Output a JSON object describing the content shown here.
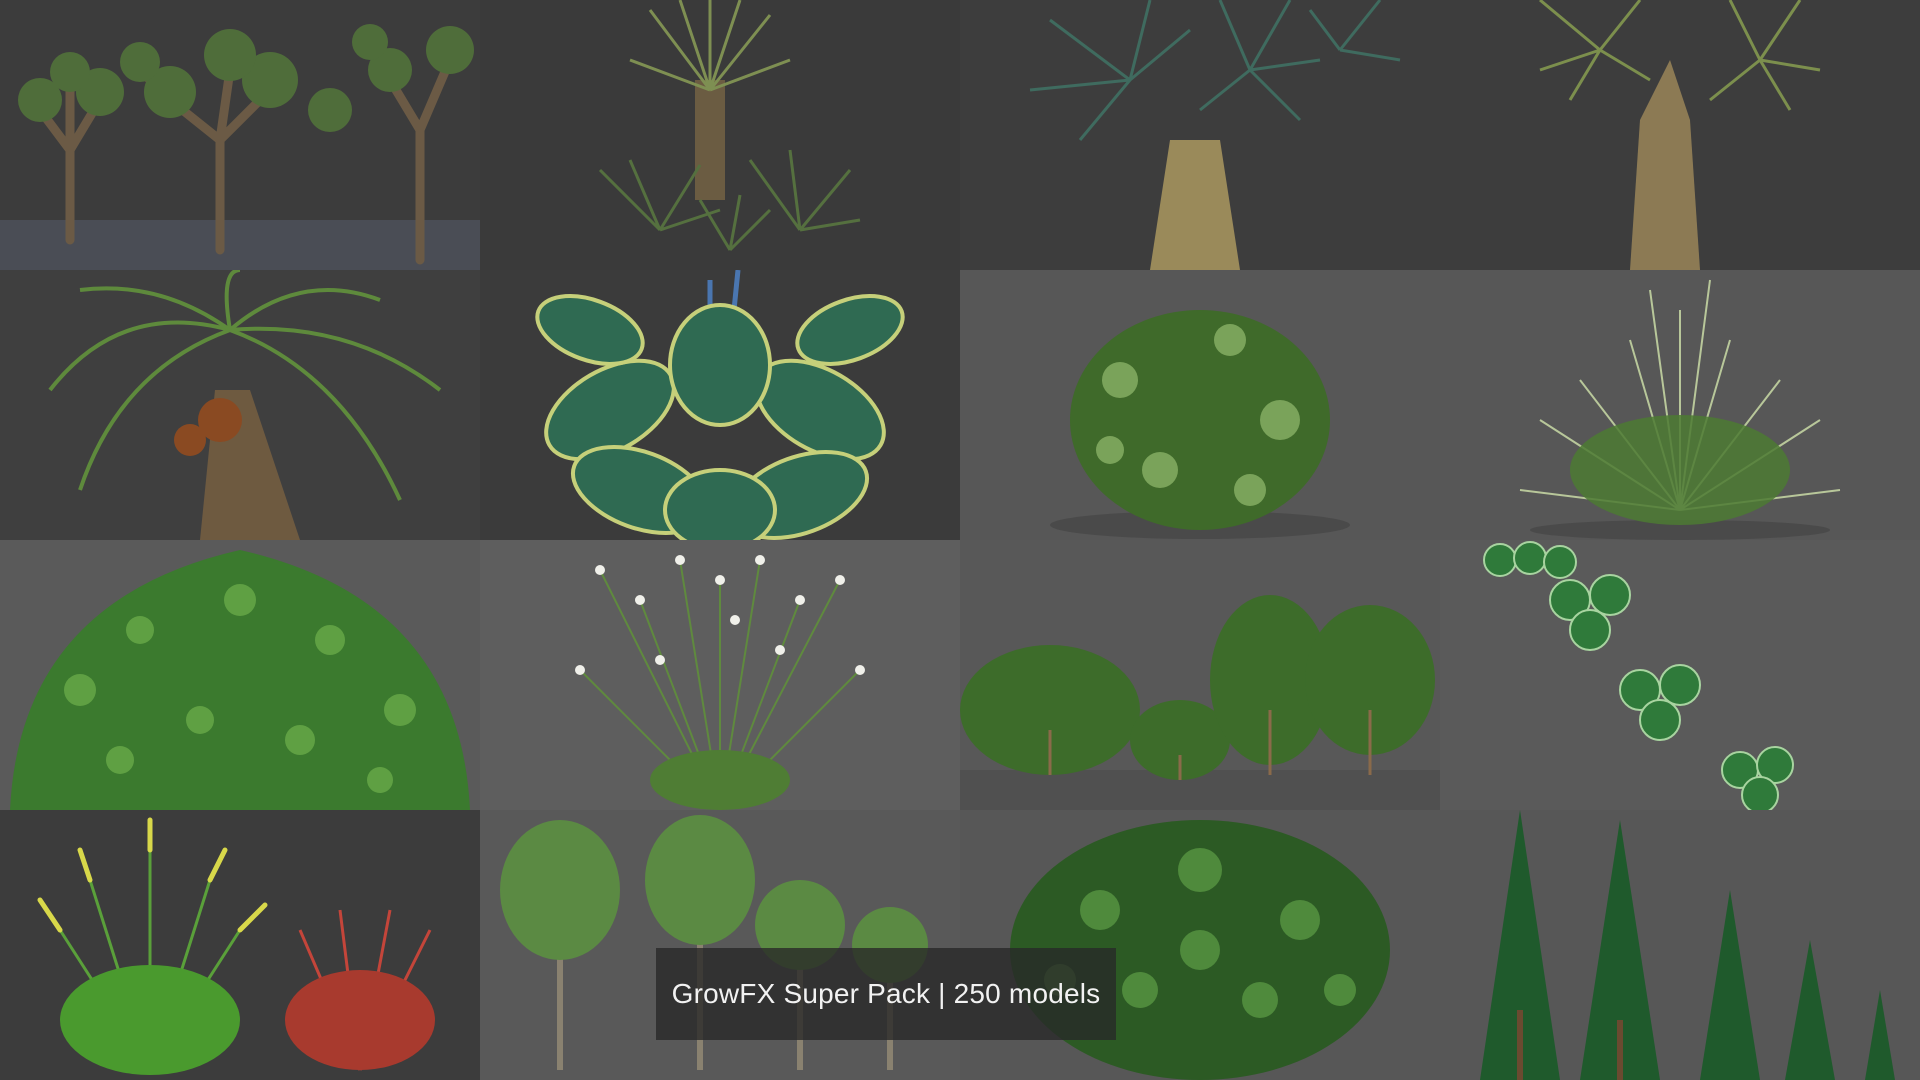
{
  "caption": "GrowFX Super Pack | 250 models",
  "tiles": [
    {
      "id": "joshua-trees",
      "subject": "Joshua trees"
    },
    {
      "id": "grass-tree",
      "subject": "Grass tree"
    },
    {
      "id": "yucca-rostrata-1",
      "subject": "Yucca palm"
    },
    {
      "id": "yucca-rostrata-2",
      "subject": "Yucca palm"
    },
    {
      "id": "date-palm",
      "subject": "Date palm"
    },
    {
      "id": "hosta",
      "subject": "Hosta"
    },
    {
      "id": "shrub-1",
      "subject": "Shrub"
    },
    {
      "id": "ornamental-grass",
      "subject": "Ornamental grass"
    },
    {
      "id": "weeping-shrub",
      "subject": "Weeping shrub"
    },
    {
      "id": "daisies",
      "subject": "Daisies"
    },
    {
      "id": "shrub-row",
      "subject": "Shrubs"
    },
    {
      "id": "clover",
      "subject": "Clover"
    },
    {
      "id": "fountain-grass",
      "subject": "Fountain grass"
    },
    {
      "id": "young-trees",
      "subject": "Young trees"
    },
    {
      "id": "boxwood-bush",
      "subject": "Bush"
    },
    {
      "id": "conifers",
      "subject": "Conifers"
    }
  ],
  "colors": {
    "bg_dark": "#3b3b3b",
    "bg_mid": "#555555",
    "foliage_dark": "#2f5a28",
    "foliage_light": "#6da04a",
    "trunk": "#7a6248",
    "caption_bg": "#282828"
  }
}
